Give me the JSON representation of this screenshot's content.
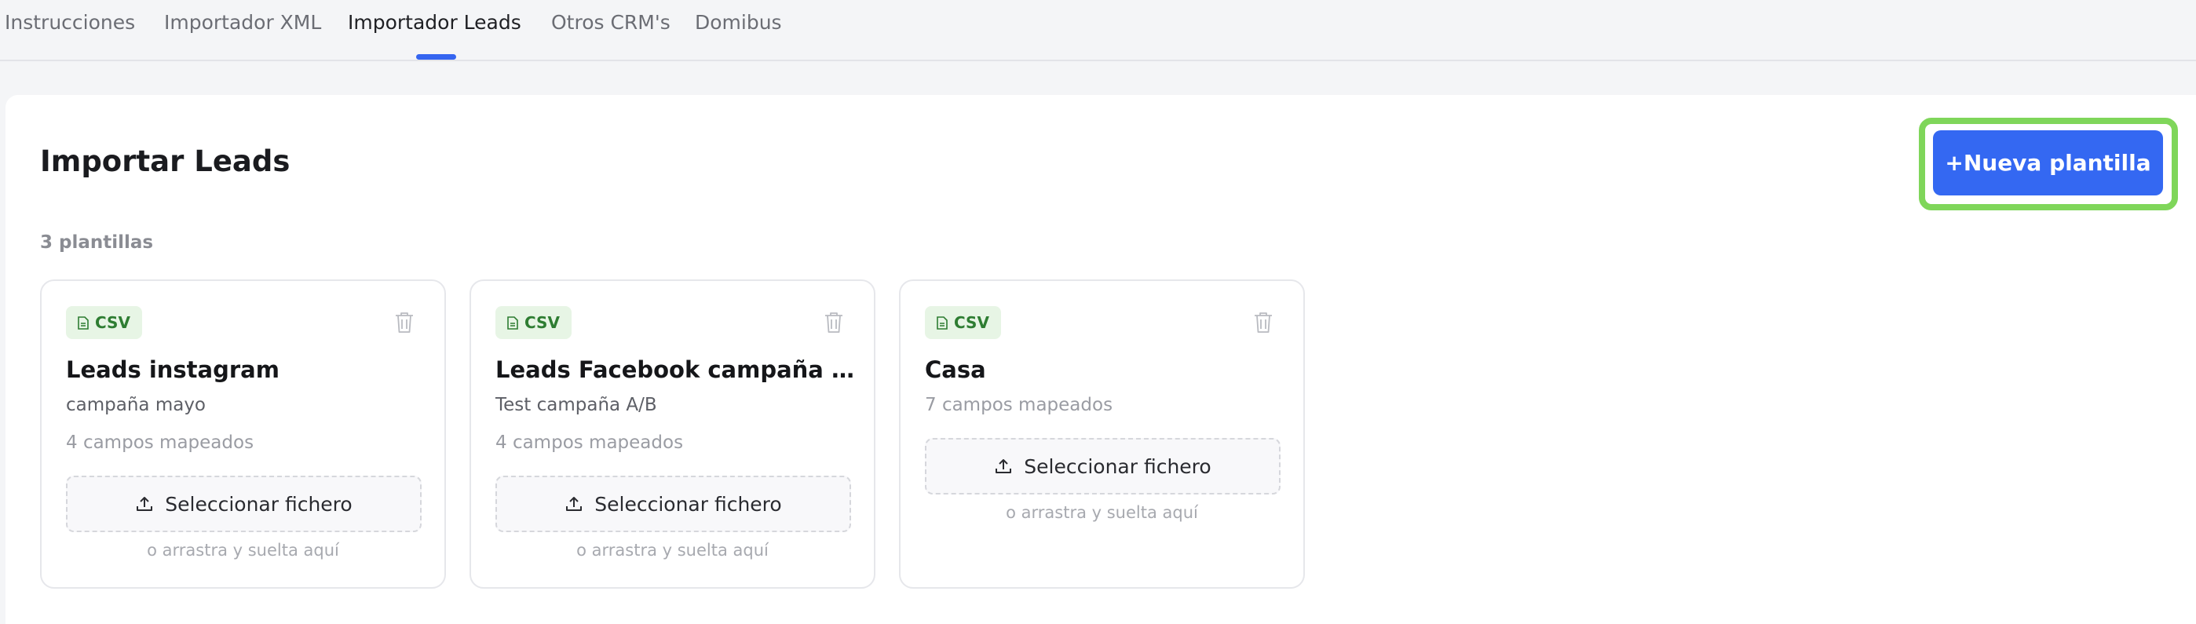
{
  "tabs": [
    {
      "label": "Instrucciones",
      "active": false
    },
    {
      "label": "Importador XML",
      "active": false
    },
    {
      "label": "Importador Leads",
      "active": true
    },
    {
      "label": "Otros CRM's",
      "active": false
    },
    {
      "label": "Domibus",
      "active": false
    }
  ],
  "page": {
    "title": "Importar Leads",
    "new_template_button": "+Nueva plantilla",
    "template_count": "3 plantillas"
  },
  "templates": [
    {
      "badge": "CSV",
      "name": "Leads instagram",
      "description": "campaña mayo",
      "fields": "4 campos mapeados",
      "upload_label": "Seleccionar fichero",
      "drop_hint": "o arrastra y suelta aquí"
    },
    {
      "badge": "CSV",
      "name": "Leads Facebook campaña M...",
      "description": "Test campaña A/B",
      "fields": "4 campos mapeados",
      "upload_label": "Seleccionar fichero",
      "drop_hint": "o arrastra y suelta aquí"
    },
    {
      "badge": "CSV",
      "name": "Casa",
      "description": "",
      "fields": "7 campos mapeados",
      "upload_label": "Seleccionar fichero",
      "drop_hint": "o arrastra y suelta aquí"
    }
  ],
  "colors": {
    "accent": "#3468f2",
    "tab_underline": "#3565f0",
    "highlight": "#7fd65a",
    "badge_bg": "#e7f5e5",
    "badge_text": "#2e7d32"
  },
  "icons": {
    "badge": "file-icon",
    "delete": "trash-icon",
    "upload": "upload-icon"
  }
}
